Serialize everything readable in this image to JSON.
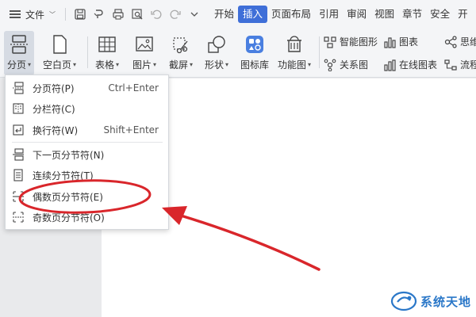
{
  "menubar": {
    "file_label": "文件",
    "tabs": [
      {
        "label": "开始"
      },
      {
        "label": "插入"
      },
      {
        "label": "页面布局"
      },
      {
        "label": "引用"
      },
      {
        "label": "审阅"
      },
      {
        "label": "视图"
      },
      {
        "label": "章节"
      },
      {
        "label": "安全"
      },
      {
        "label": "开"
      }
    ],
    "active_tab": "插入"
  },
  "ribbon": {
    "page_break": "分页",
    "blank_page": "空白页",
    "table": "表格",
    "picture": "图片",
    "screenshot": "截屏",
    "shape": "形状",
    "icon_lib": "图标库",
    "func_chart": "功能图",
    "smart_graphic": "智能图形",
    "chart": "图表",
    "mind_map": "思维",
    "relation_chart": "关系图",
    "online_chart": "在线图表",
    "flow_chart": "流程"
  },
  "dropdown": {
    "items": [
      {
        "label": "分页符(P)",
        "shortcut": "Ctrl+Enter"
      },
      {
        "label": "分栏符(C)",
        "shortcut": ""
      },
      {
        "label": "换行符(W)",
        "shortcut": "Shift+Enter"
      },
      {
        "label": "下一页分节符(N)",
        "shortcut": ""
      },
      {
        "label": "连续分节符(T)",
        "shortcut": ""
      },
      {
        "label": "偶数页分节符(E)",
        "shortcut": ""
      },
      {
        "label": "奇数页分节符(O)",
        "shortcut": ""
      }
    ]
  },
  "watermark": {
    "text": "系统天地"
  },
  "colors": {
    "accent": "#3f6fd8",
    "annotation": "#d9262b",
    "watermark": "#2a77c8"
  }
}
